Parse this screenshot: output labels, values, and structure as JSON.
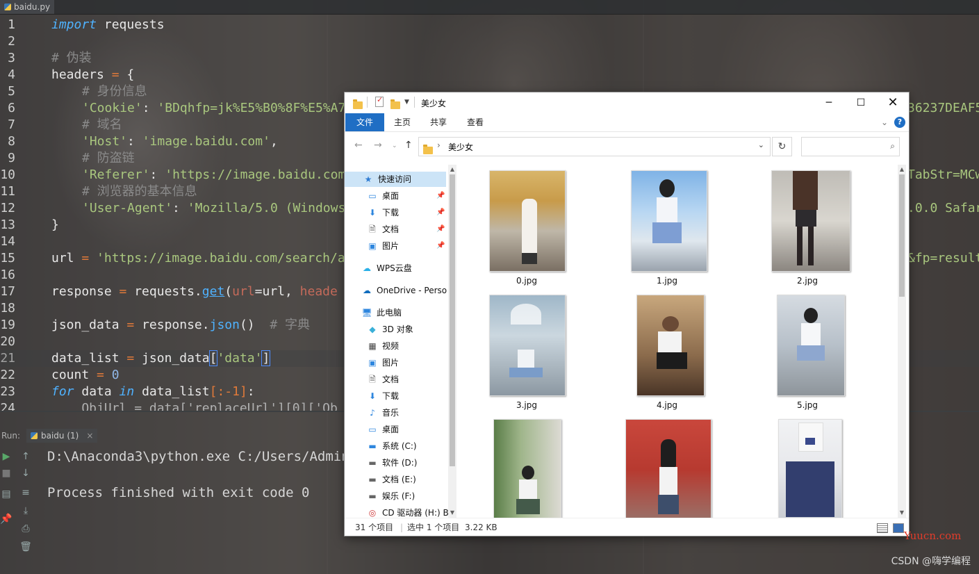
{
  "ide": {
    "tab_title": "baidu.py",
    "code_lines": [
      {
        "n": "1"
      },
      {
        "n": "2"
      },
      {
        "n": "3"
      },
      {
        "n": "4"
      },
      {
        "n": "5"
      },
      {
        "n": "6"
      },
      {
        "n": "7"
      },
      {
        "n": "8"
      },
      {
        "n": "9"
      },
      {
        "n": "10"
      },
      {
        "n": "11"
      },
      {
        "n": "12"
      },
      {
        "n": "13"
      },
      {
        "n": "14"
      },
      {
        "n": "15"
      },
      {
        "n": "16"
      },
      {
        "n": "17"
      },
      {
        "n": "18"
      },
      {
        "n": "19"
      },
      {
        "n": "20"
      },
      {
        "n": "21"
      },
      {
        "n": "22"
      },
      {
        "n": "23"
      },
      {
        "n": "24"
      }
    ],
    "code": {
      "l1_kw": "import",
      "l1_rest": " requests",
      "l3": "# 伪装",
      "l4_a": "headers",
      "l4_op": " = ",
      "l4_b": "{",
      "l5": "# 身份信息",
      "l6_k": "'Cookie'",
      "l6_sep": ": ",
      "l6_v": "'BDqhfp=jk%E5%B0%8F%E5%A7",
      "l6_right": "36237DEAF5",
      "l7": "# 域名",
      "l8_k": "'Host'",
      "l8_sep": ": ",
      "l8_v": "'image.baidu.com'",
      "l8_end": ",",
      "l9": "# 防盗链",
      "l10_k": "'Referer'",
      "l10_sep": ": ",
      "l10_v": "'https://image.baidu.com",
      "l10_right": "TabStr=MCw",
      "l11": "# 浏览器的基本信息",
      "l12_k": "'User-Agent'",
      "l12_sep": ": ",
      "l12_v": "'Mozilla/5.0 (Windows",
      "l12_right": ".0.0 Safar",
      "l13": "}",
      "l15_a": "url",
      "l15_op": " = ",
      "l15_v": "'https://image.baidu.com/search/a",
      "l15_right": "&fp=result",
      "l17_a": "response",
      "l17_op": " = ",
      "l17_b": "requests.",
      "l17_fn": "get",
      "l17_c": "(",
      "l17_p": "url",
      "l17_d": "=url, ",
      "l17_p2": "heade",
      "l19_a": "json_data",
      "l19_op": " = ",
      "l19_b": "response.",
      "l19_fn": "json",
      "l19_c": "()",
      "l19_cm": "  # 字典",
      "l21_a": "data_list",
      "l21_op": " = ",
      "l21_b": "json_data",
      "l21_c": "[",
      "l21_s": "'data'",
      "l21_d": "]",
      "l22_a": "count",
      "l22_op": " = ",
      "l22_n": "0",
      "l23_kw": "for",
      "l23_b": " data ",
      "l23_kw2": "in",
      "l23_c": " data_list",
      "l23_d": "[:-1]",
      "l23_e": ":",
      "l24": "    ObjUrl = data['replaceUrl'][0]['Ob"
    },
    "run": {
      "label": "Run:",
      "tab": "baidu (1)",
      "output_line1": "D:\\Anaconda3\\python.exe C:/Users/Admini",
      "output_line2": "Process finished with exit code 0"
    }
  },
  "explorer": {
    "title": "美少女",
    "ribbon_tabs": [
      "文件",
      "主页",
      "共享",
      "查看"
    ],
    "address": "美少女",
    "nav": {
      "quick_access": "快速访问",
      "items": [
        "桌面",
        "下载",
        "文档",
        "图片"
      ],
      "wps": "WPS云盘",
      "onedrive": "OneDrive - Perso",
      "this_pc": "此电脑",
      "pc_items": [
        "3D 对象",
        "视频",
        "图片",
        "文档",
        "下载",
        "音乐",
        "桌面"
      ],
      "drives": [
        "系统 (C:)",
        "软件 (D:)",
        "文档 (E:)",
        "娱乐 (F:)",
        "CD 驱动器 (H:) B"
      ]
    },
    "files": [
      "0.jpg",
      "1.jpg",
      "2.jpg",
      "3.jpg",
      "4.jpg",
      "5.jpg",
      "",
      "",
      ""
    ],
    "status": {
      "count": "31 个项目",
      "selected": "选中 1 个项目",
      "size": "3.22 KB"
    }
  },
  "watermark": "CSDN @嗨学编程",
  "yuucn": "Yuucn.com"
}
